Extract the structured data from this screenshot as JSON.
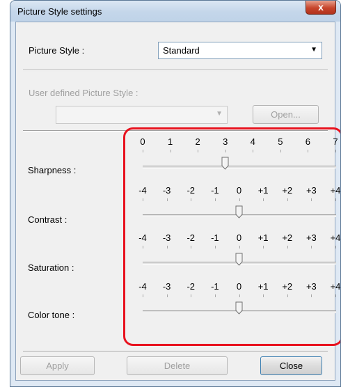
{
  "window": {
    "title": "Picture Style settings",
    "close_glyph": "x"
  },
  "picture_style": {
    "label": "Picture Style :",
    "value": "Standard"
  },
  "user_defined": {
    "label": "User defined Picture Style :",
    "value": "",
    "open_label": "Open..."
  },
  "sliders": [
    {
      "name": "sharpness",
      "label": "Sharpness :",
      "ticks": [
        "0",
        "1",
        "2",
        "3",
        "4",
        "5",
        "6",
        "7"
      ],
      "value": "3"
    },
    {
      "name": "contrast",
      "label": "Contrast :",
      "ticks": [
        "-4",
        "-3",
        "-2",
        "-1",
        "0",
        "+1",
        "+2",
        "+3",
        "+4"
      ],
      "value": "0"
    },
    {
      "name": "saturation",
      "label": "Saturation :",
      "ticks": [
        "-4",
        "-3",
        "-2",
        "-1",
        "0",
        "+1",
        "+2",
        "+3",
        "+4"
      ],
      "value": "0"
    },
    {
      "name": "color-tone",
      "label": "Color tone :",
      "ticks": [
        "-4",
        "-3",
        "-2",
        "-1",
        "0",
        "+1",
        "+2",
        "+3",
        "+4"
      ],
      "value": "0"
    }
  ],
  "buttons": {
    "apply": "Apply",
    "delete": "Delete",
    "close": "Close"
  },
  "colors": {
    "highlight": "#e8121e",
    "title_bar": "#c4d6ea"
  }
}
